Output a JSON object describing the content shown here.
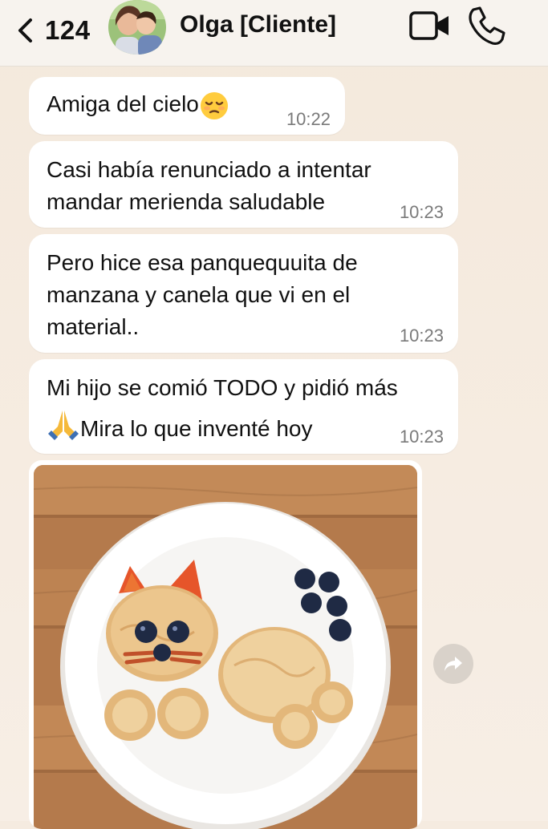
{
  "header": {
    "back_count": "124",
    "contact_name": "Olga [Cliente]"
  },
  "messages": [
    {
      "text_lines": [
        "Amiga del cielo"
      ],
      "emoji": "pensive-face",
      "time": "10:22"
    },
    {
      "text_lines": [
        "Casi había renunciado a intentar",
        "mandar merienda saludable"
      ],
      "time": "10:23"
    },
    {
      "text_lines": [
        "Pero hice esa panquequuita de",
        "manzana y canela que vi en el",
        "material.."
      ],
      "time": "10:23"
    },
    {
      "text_lines": [
        "Mi hijo se comió TODO y pidió más",
        "Mira lo que inventé hoy"
      ],
      "emoji": "folded-hands",
      "time": "10:23"
    }
  ],
  "image_message": {
    "subject": "cat-shaped-pancakes-on-plate"
  },
  "colors": {
    "chat_background": "#f5ebe0",
    "bubble": "#ffffff",
    "header": "#f7f3ee",
    "time_text": "#7a7a7a"
  }
}
